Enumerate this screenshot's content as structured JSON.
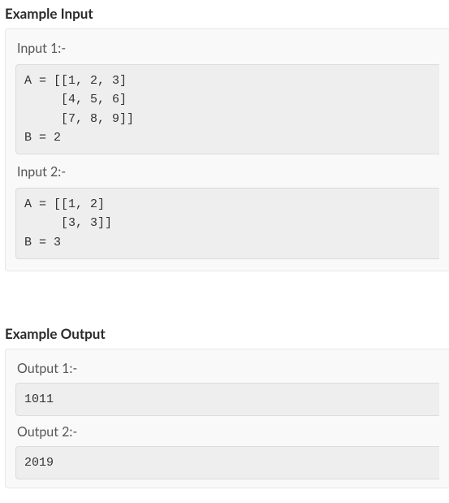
{
  "input_section": {
    "heading": "Example Input",
    "blocks": [
      {
        "label": "Input 1:-",
        "code": "A = [[1, 2, 3]\n     [4, 5, 6]\n     [7, 8, 9]]\nB = 2"
      },
      {
        "label": "Input 2:-",
        "code": "A = [[1, 2]\n     [3, 3]]\nB = 3"
      }
    ]
  },
  "output_section": {
    "heading": "Example Output",
    "blocks": [
      {
        "label": "Output 1:-",
        "code": "1011"
      },
      {
        "label": "Output 2:-",
        "code": "2019"
      }
    ]
  }
}
